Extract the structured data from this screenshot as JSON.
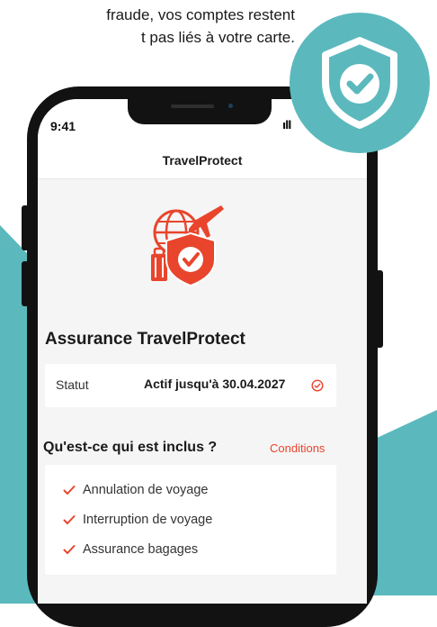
{
  "promo": {
    "line1": "fraude, vos comptes restent",
    "line2": "t pas liés à votre carte."
  },
  "badge_icon": "shield-check-icon",
  "colors": {
    "teal": "#5bb9bd",
    "accent_red": "#e8452c",
    "phone_frame": "#121212",
    "screen_bg": "#f5f5f5"
  },
  "phone": {
    "status_bar": {
      "time": "9:41",
      "signal": "ıll"
    },
    "nav_title": "TravelProtect",
    "hero_icon": "travel-insurance-icon",
    "section_title": "Assurance TravelProtect",
    "status": {
      "label": "Statut",
      "value": "Actif jusqu'à 30.04.2027",
      "icon": "check-circle-icon"
    },
    "included": {
      "title": "Qu'est-ce qui est inclus ?",
      "conditions_link": "Conditions",
      "items": [
        "Annulation de voyage",
        "Interruption de voyage",
        "Assurance bagages"
      ]
    }
  }
}
